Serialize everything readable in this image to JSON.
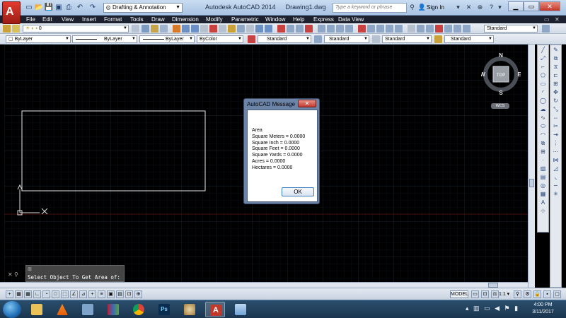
{
  "app": {
    "title": "Autodesk AutoCAD 2014",
    "document": "Drawing1.dwg",
    "logo_letter": "A"
  },
  "workspace": {
    "label": "Drafting & Annotation"
  },
  "search": {
    "placeholder": "Type a keyword or phrase"
  },
  "account": {
    "sign_in": "Sign In"
  },
  "menu": [
    "File",
    "Edit",
    "View",
    "Insert",
    "Format",
    "Tools",
    "Draw",
    "Dimension",
    "Modify",
    "Parametric",
    "Window",
    "Help",
    "Express",
    "Data View"
  ],
  "toolbar": {
    "layer_value": "0",
    "style_dropdown": "Standard",
    "color": "ByLayer",
    "linetype": "ByLayer",
    "lineweight": "ByLayer",
    "plotstyle": "ByColor",
    "textstyle": "Standard",
    "dimstyle": "Standard",
    "tablestyle": "Standard",
    "mleaderstyle": "Standard"
  },
  "help_tab": "?",
  "viewcube": {
    "north": "N",
    "south": "S",
    "east": "E",
    "west": "W",
    "face": "TOP",
    "ucs": "WCS"
  },
  "dialog": {
    "title": "AutoCAD Message",
    "close": "✕",
    "lines": [
      "Area",
      "Square Meters = 0.0000",
      "Square Inch = 0.0000",
      "Square Feet = 0.0000",
      "Square Yards = 0.0000",
      "Acres = 0.0000",
      "Hectares = 0.0000"
    ],
    "ok_label": "OK"
  },
  "command": {
    "history": "⊞",
    "prompt": "Select Object To Get Area of:"
  },
  "status": {
    "model": "MODEL",
    "scale": "1:1 ▾"
  },
  "clock": {
    "time": "4:00 PM",
    "date": "3/11/2017"
  },
  "colors": {
    "accent_red": "#c0392b",
    "grid": "#1f2a38",
    "crosshair_red": "#5a1010"
  }
}
